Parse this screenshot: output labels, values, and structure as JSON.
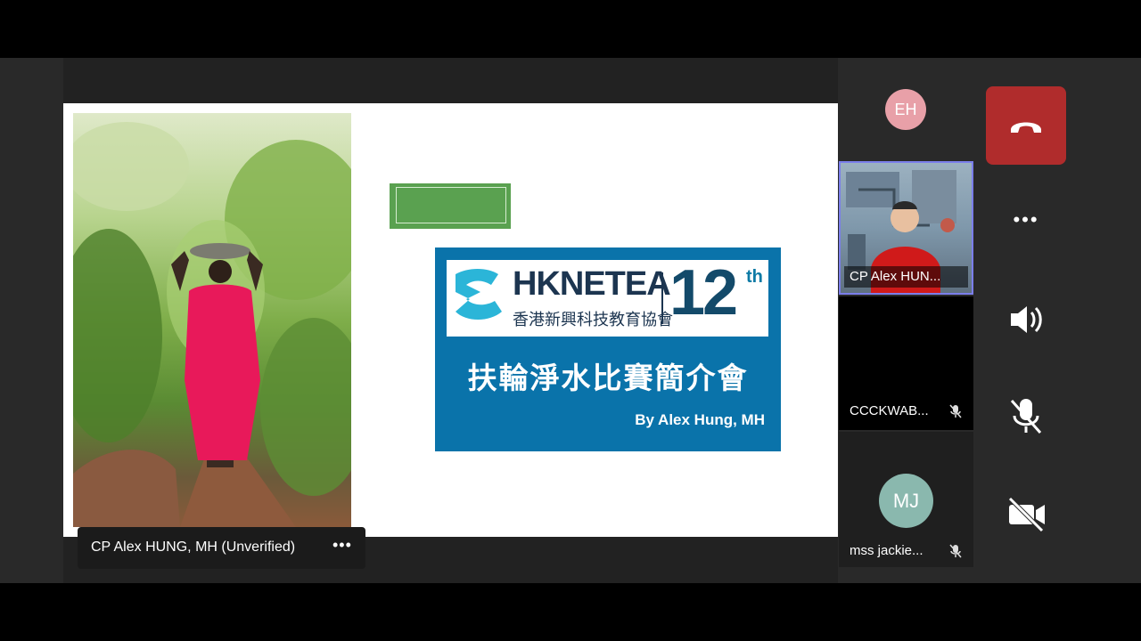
{
  "presenter": {
    "name_label": "CP Alex HUNG, MH (Unverified)",
    "more_glyph": "•••"
  },
  "slide": {
    "logo_name": "HKNETEA",
    "logo_zh": "香港新興科技教育協會",
    "logo_num": "12",
    "logo_suffix": "th",
    "title": "扶輪淨水比賽簡介會",
    "byline": "By Alex Hung, MH"
  },
  "participants": [
    {
      "initials": "EH",
      "color": "#e8a0a8"
    },
    {
      "name": "CP Alex HUN...",
      "video": true
    },
    {
      "name": "CCCKWAB...",
      "muted": true
    },
    {
      "initials": "MJ",
      "name": "mss jackie...",
      "color": "#8ab8ae",
      "muted": true
    }
  ],
  "controls": {
    "hangup_icon": "phone-hangup-icon",
    "more_glyph": "•••",
    "speaker_icon": "speaker-icon",
    "mic_icon": "mic-off-icon",
    "camera_icon": "camera-off-icon",
    "hangup_color": "#b02c2c"
  }
}
